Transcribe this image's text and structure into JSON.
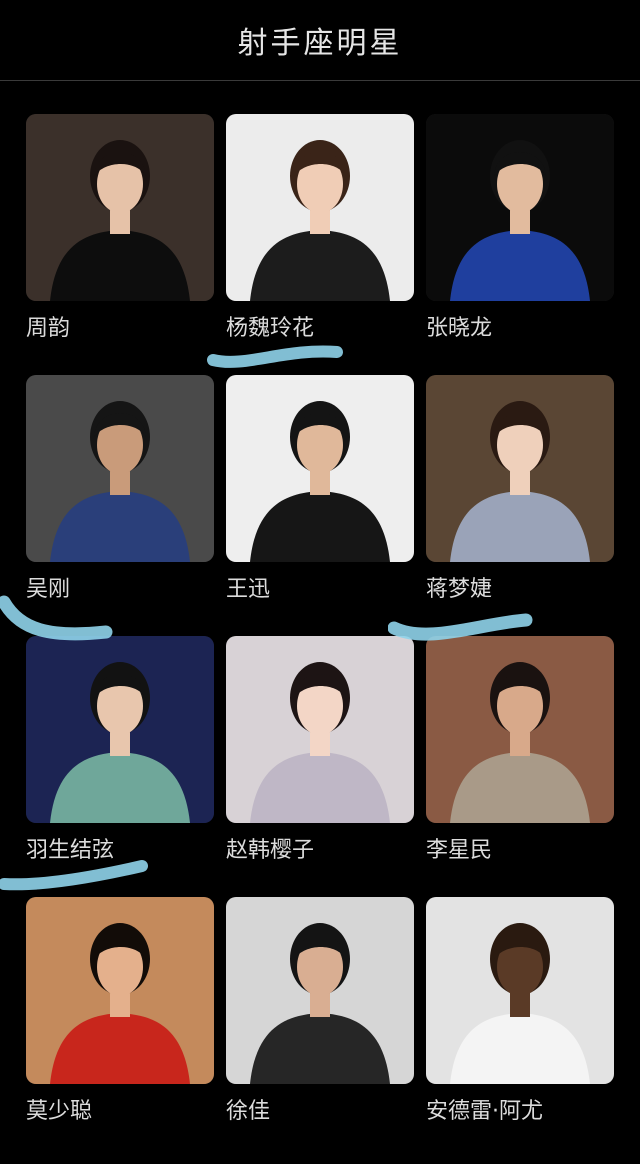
{
  "header": {
    "title": "射手座明星"
  },
  "celebrities": [
    {
      "name": "周韵",
      "bg": "#3b302a",
      "clothes": "#0d0d0d",
      "skin": "#e6c2a8",
      "hair": "#1a1210",
      "photo_icon": "woman-black-dress-photo"
    },
    {
      "name": "杨魏玲花",
      "bg": "#ececec",
      "clothes": "#1c1c1c",
      "skin": "#f0cdb6",
      "hair": "#3a2418",
      "photo_icon": "woman-striped-dress-photo"
    },
    {
      "name": "张晓龙",
      "bg": "#0b0b0b",
      "clothes": "#1f3f9e",
      "skin": "#e2bb9e",
      "hair": "#111111",
      "photo_icon": "man-blue-suit-photo"
    },
    {
      "name": "吴刚",
      "bg": "#4a4a4a",
      "clothes": "#2a3f7a",
      "skin": "#c99b7a",
      "hair": "#151515",
      "photo_icon": "man-check-suit-photo"
    },
    {
      "name": "王迅",
      "bg": "#eeeeee",
      "clothes": "#161616",
      "skin": "#e0b89a",
      "hair": "#141414",
      "photo_icon": "man-tuxedo-photo"
    },
    {
      "name": "蒋梦婕",
      "bg": "#5a4634",
      "clothes": "#9aa3b8",
      "skin": "#efd0bb",
      "hair": "#2a1a12",
      "photo_icon": "woman-seated-photo"
    },
    {
      "name": "羽生结弦",
      "bg": "#1c2453",
      "clothes": "#6fa79a",
      "skin": "#e8c6ad",
      "hair": "#121212",
      "photo_icon": "skater-photo"
    },
    {
      "name": "赵韩樱子",
      "bg": "#d8d2d6",
      "clothes": "#bfb7c6",
      "skin": "#f3d6c6",
      "hair": "#1d1414",
      "photo_icon": "woman-veil-photo"
    },
    {
      "name": "李星民",
      "bg": "#8a5a44",
      "clothes": "#a99a88",
      "skin": "#d8a98a",
      "hair": "#1a1210",
      "photo_icon": "man-glasses-photo"
    },
    {
      "name": "莫少聪",
      "bg": "#c48a5c",
      "clothes": "#c8261c",
      "skin": "#e4b08c",
      "hair": "#120c08",
      "photo_icon": "man-red-jacket-photo"
    },
    {
      "name": "徐佳",
      "bg": "#d6d6d6",
      "clothes": "#262626",
      "skin": "#d9ae92",
      "hair": "#141414",
      "photo_icon": "man-dark-suit-photo"
    },
    {
      "name": "安德雷·阿尤",
      "bg": "#e3e3e3",
      "clothes": "#f4f4f4",
      "skin": "#5a3a26",
      "hair": "#2a1a10",
      "photo_icon": "footballer-photo"
    }
  ],
  "annotations": {
    "scribble_color": "#8fd3ea"
  }
}
